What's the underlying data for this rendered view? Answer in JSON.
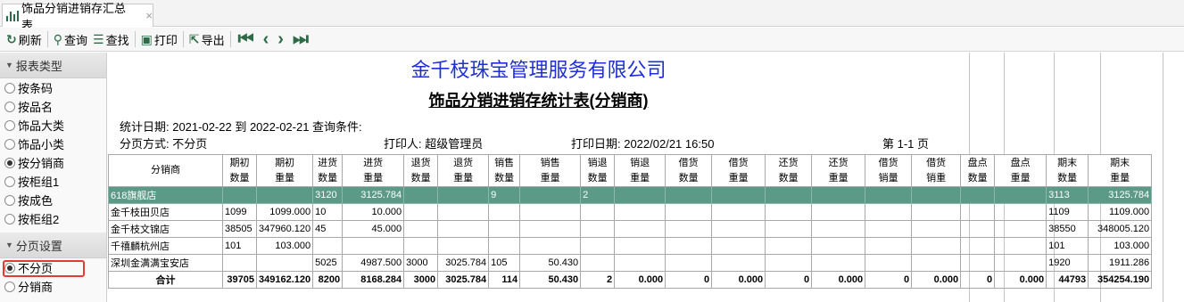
{
  "tab": {
    "title": "饰品分销进销存汇总表",
    "close": "×"
  },
  "toolbar": {
    "refresh": "刷新",
    "query": "查询",
    "find": "查找",
    "print": "打印",
    "export": "导出"
  },
  "sidebar": {
    "report_type_title": "报表类型",
    "report_types": [
      "按条码",
      "按品名",
      "饰品大类",
      "饰品小类",
      "按分销商",
      "按柜组1",
      "按成色",
      "按柜组2"
    ],
    "report_type_selected": 4,
    "paging_title": "分页设置",
    "paging_options": [
      "不分页",
      "分销商"
    ],
    "paging_selected": 0
  },
  "report": {
    "company": "金千枝珠宝管理服务有限公司",
    "title": "饰品分销进销存统计表(分销商)",
    "date_range": "统计日期:  2021-02-22 到 2022-02-21  查询条件:",
    "paging": "分页方式:  不分页",
    "printer": "打印人:  超级管理员",
    "print_date": "打印日期:  2022/02/21 16:50",
    "page": "第 1-1 页",
    "columns": [
      "分销商",
      "期初\n数量",
      "期初\n重量",
      "进货\n数量",
      "进货\n重量",
      "退货\n数量",
      "退货\n重量",
      "销售\n数量",
      "销售\n重量",
      "销退\n数量",
      "销退\n重量",
      "借货\n数量",
      "借货\n重量",
      "还货\n数量",
      "还货\n重量",
      "借货\n销量",
      "借货\n销重",
      "盘点\n数量",
      "盘点\n重量",
      "期末\n数量",
      "期末\n重量"
    ],
    "rows": [
      [
        "618旗舰店",
        "",
        "",
        "3120",
        "3125.784",
        "",
        "",
        "9",
        "",
        "2",
        "",
        "",
        "",
        "",
        "",
        "",
        "",
        "",
        "",
        "3113",
        "3125.784"
      ],
      [
        "金千枝田贝店",
        "1099",
        "1099.000",
        "10",
        "10.000",
        "",
        "",
        "",
        "",
        "",
        "",
        "",
        "",
        "",
        "",
        "",
        "",
        "",
        "",
        "1109",
        "1109.000"
      ],
      [
        "金千枝文锦店",
        "38505",
        "347960.120",
        "45",
        "45.000",
        "",
        "",
        "",
        "",
        "",
        "",
        "",
        "",
        "",
        "",
        "",
        "",
        "",
        "",
        "38550",
        "348005.120"
      ],
      [
        "千禧麟杭州店",
        "101",
        "103.000",
        "",
        "",
        "",
        "",
        "",
        "",
        "",
        "",
        "",
        "",
        "",
        "",
        "",
        "",
        "",
        "",
        "101",
        "103.000"
      ],
      [
        "深圳金满满宝安店",
        "",
        "",
        "5025",
        "4987.500",
        "3000",
        "3025.784",
        "105",
        "50.430",
        "",
        "",
        "",
        "",
        "",
        "",
        "",
        "",
        "",
        "",
        "1920",
        "1911.286"
      ],
      [
        "合计",
        "39705",
        "349162.120",
        "8200",
        "8168.284",
        "3000",
        "3025.784",
        "114",
        "50.430",
        "2",
        "0.000",
        "0",
        "0.000",
        "0",
        "0.000",
        "0",
        "0.000",
        "0",
        "0.000",
        "44793",
        "354254.190"
      ]
    ]
  }
}
